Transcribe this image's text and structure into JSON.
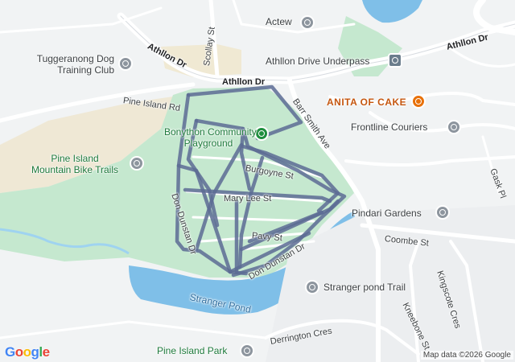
{
  "map": {
    "attribution": "Map data ©2026 Google",
    "logo_letters": [
      {
        "ch": "G",
        "color": "#4285F4"
      },
      {
        "ch": "o",
        "color": "#EA4335"
      },
      {
        "ch": "o",
        "color": "#FBBC05"
      },
      {
        "ch": "g",
        "color": "#4285F4"
      },
      {
        "ch": "l",
        "color": "#34A853"
      },
      {
        "ch": "e",
        "color": "#EA4335"
      }
    ],
    "colors": {
      "park": "#c5e8cf",
      "land": "#f1f3f4",
      "water": "#7fbfe8",
      "route": "#5c6b94",
      "road": "#ffffff",
      "sand": "#f0e9d6"
    }
  },
  "places": {
    "actew": "Actew",
    "dog_club": "Tuggeranong Dog\nTraining Club",
    "underpass": "Athllon Drive Underpass",
    "anita": "ANITA OF CAKE",
    "playground": "Bonython Community\nPlayground",
    "frontline": "Frontline Couriers",
    "mtb": "Pine Island\nMountain Bike Trails",
    "pindari": "Pindari Gardens",
    "stranger_trail": "Stranger pond Trail",
    "pine_island_park": "Pine Island Park"
  },
  "roads": {
    "athllon_dr_1": "Athllon Dr",
    "athllon_dr_2": "Athllon Dr",
    "athllon_dr_3": "Athllon Dr",
    "scollay": "Scollay St",
    "pine_island_rd": "Pine Island Rd",
    "barr_smith": "Barr Smith Ave",
    "burgoyne": "Burgoyne St",
    "mary_lee": "Mary Lee St",
    "pavy": "Pavy St",
    "don_dunstan_1": "Don Dunstan Dr",
    "don_dunstan_2": "Don Dunstan Dr",
    "coombe": "Coombe St",
    "kneebone": "Kneebone St",
    "kingscote": "Kingscote Cres",
    "gask": "Gask Pl",
    "derrington": "Derrington Cres"
  },
  "water": {
    "stranger_pond": "Stranger Pond"
  }
}
